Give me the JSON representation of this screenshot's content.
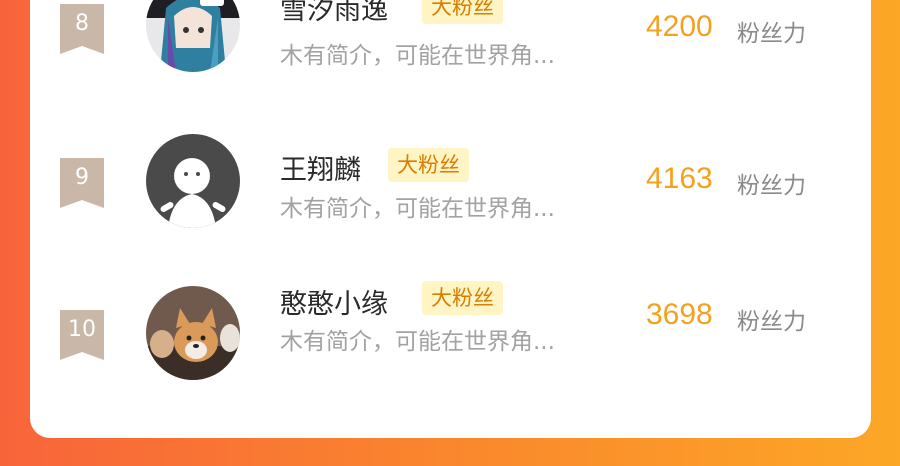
{
  "leaderboard": {
    "rows": [
      {
        "rank": "8",
        "name": "雪汐雨逸",
        "tag": "大粉丝",
        "bio": "木有简介，可能在世界角...",
        "score": "4200",
        "unit": "粉丝力",
        "avatar_icon": "anime-girl-avatar"
      },
      {
        "rank": "9",
        "name": "王翔麟",
        "tag": "大粉丝",
        "bio": "木有简介，可能在世界角...",
        "score": "4163",
        "unit": "粉丝力",
        "avatar_icon": "default-person-avatar"
      },
      {
        "rank": "10",
        "name": "憨憨小缘",
        "tag": "大粉丝",
        "bio": "木有简介，可能在世界角...",
        "score": "3698",
        "unit": "粉丝力",
        "avatar_icon": "corgi-dogs-avatar"
      }
    ]
  },
  "colors": {
    "score": "#f3a11e",
    "tag_bg": "#fff4c4",
    "tag_text": "#d97e00",
    "rank_badge": "#c9b8a8"
  }
}
